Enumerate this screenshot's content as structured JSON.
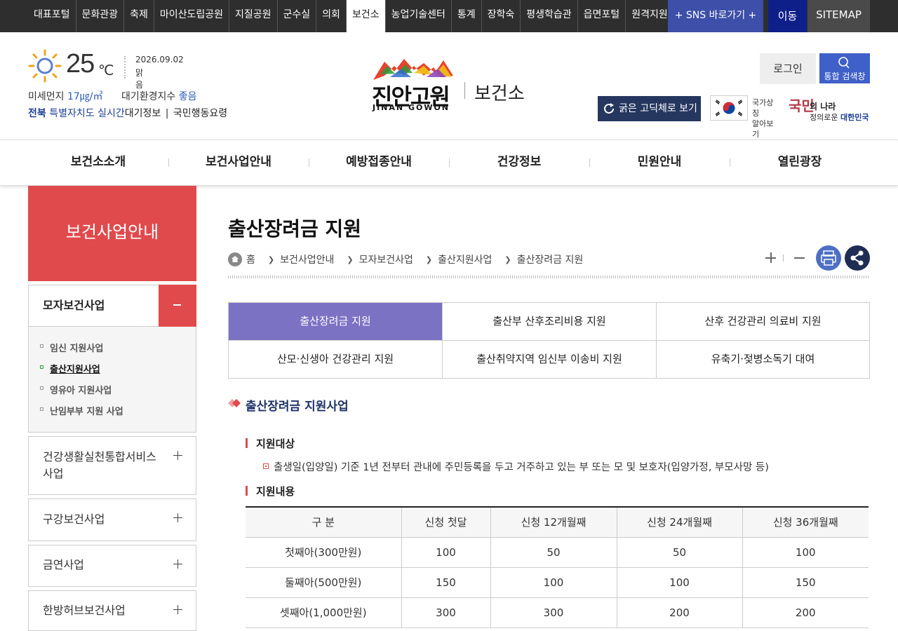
{
  "topbar": {
    "links": [
      "대표포털",
      "문화관광",
      "축제",
      "마이산도립공원",
      "지질공원",
      "군수실",
      "의회",
      "보건소",
      "농업기술센터",
      "통계",
      "장학숙",
      "평생학습관",
      "읍면포털",
      "원격지원"
    ],
    "active_index": 7,
    "sns": "+ SNS 바로가기 +",
    "move": "이동",
    "sitemap": "SITEMAP"
  },
  "weather": {
    "temp": "25",
    "unit": "℃",
    "date": "2026.09.02",
    "condition": "맑음",
    "icon": "sun-icon",
    "dust_label": "미세먼지",
    "dust_value": "17㎍/㎥",
    "air_label": "대기환경지수",
    "air_value": "좋음",
    "region": "전북",
    "region2": "특별자치도",
    "realtime": "실시간",
    "air_info": "대기정보",
    "action": "국민행동요령"
  },
  "logo": {
    "name": "진안고원",
    "eng": "JINAN GOWON",
    "dept": "보건소"
  },
  "header": {
    "login": "로그인",
    "search": "통합 검색창",
    "gothic": "굵은 고딕체로 보기",
    "flag_text_1": "국가상징",
    "flag_text_2": "알아보기",
    "citizen_1": "국민",
    "citizen_2": "의 나라",
    "citizen_3": "정의로운",
    "citizen_4": "대한민국"
  },
  "gnb": [
    "보건소소개",
    "보건사업안내",
    "예방접종안내",
    "건강정보",
    "민원안내",
    "열린광장"
  ],
  "sidebar": {
    "title": "보건사업안내",
    "active": "모자보건사업",
    "sub": [
      {
        "label": "임신 지원사업",
        "on": false
      },
      {
        "label": "출산지원사업",
        "on": true
      },
      {
        "label": "영유아 지원사업",
        "on": false
      },
      {
        "label": "난임부부 지원 사업",
        "on": false
      }
    ],
    "items": [
      "건강생활실천통합서비스사업",
      "구강보건사업",
      "금연사업",
      "한방허브보건사업"
    ]
  },
  "content": {
    "title": "출산장려금 지원",
    "breadcrumb": [
      "홈",
      "보건사업안내",
      "모자보건사업",
      "출산지원사업",
      "출산장려금 지원"
    ],
    "tabs": [
      "출산장려금 지원",
      "출산부 산후조리비용 지원",
      "산후 건강관리 의료비 지원",
      "산모·신생아 건강관리 지원",
      "출산취약지역 임신부 이송비 지원",
      "유축기·젖병소독기 대여"
    ],
    "active_tab": 0,
    "section_title": "출산장려금 지원사업",
    "target_title": "지원대상",
    "target_text": "출생일(입양일) 기준 1년 전부터 관내에 주민등록을 두고 거주하고 있는 부 또는 모 및 보호자(입양가정, 부모사망 등)",
    "content_title": "지원내용",
    "table": {
      "headers": [
        "구 분",
        "신청 첫달",
        "신청 12개월째",
        "신청 24개월째",
        "신청 36개월째"
      ],
      "rows": [
        [
          "첫째아(300만원)",
          "100",
          "50",
          "50",
          "100"
        ],
        [
          "둘째아(500만원)",
          "150",
          "100",
          "100",
          "150"
        ],
        [
          "셋째아(1,000만원)",
          "300",
          "300",
          "200",
          "200"
        ]
      ]
    }
  },
  "colors": {
    "accent_red": "#e14a4c",
    "tab_purple": "#7b72c4",
    "navy": "#26375f",
    "blue": "#3f60c9"
  }
}
